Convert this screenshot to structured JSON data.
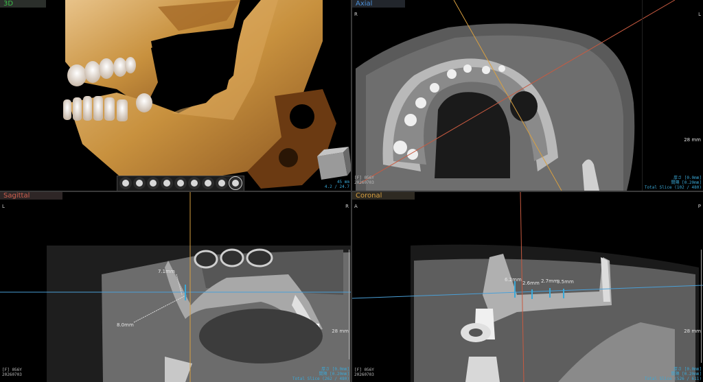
{
  "panels": {
    "threeD": {
      "title": "3D",
      "info_lines": [
        "45 mm",
        "4.2 / 24.7"
      ],
      "toolbar_icons": [
        "view-front-icon",
        "view-left-icon",
        "view-right-icon",
        "view-top-icon",
        "view-back-icon",
        "view-bottom-icon",
        "view-iso-icon",
        "view-mask-icon",
        "reset-view-icon"
      ]
    },
    "axial": {
      "title": "Axial",
      "orient_left": "R",
      "orient_right": "L",
      "scale_label": "28 mm",
      "patient_id": "[F] 056Y",
      "date": "20260703",
      "info_lines": [
        "厚さ [0.0mm]",
        "間隔 [0.20mm]",
        "Total Slice (102 / 480)"
      ]
    },
    "sagittal": {
      "title": "Sagittal",
      "orient_left": "L",
      "orient_right": "R",
      "scale_label": "28 mm",
      "patient_id": "[F] 056Y",
      "date": "20260703",
      "info_lines": [
        "厚さ [0.0mm]",
        "間隔 [0.20mm]",
        "Total Slice (262 / 480)"
      ],
      "measurements": [
        "7.1mm",
        "8.0mm"
      ]
    },
    "coronal": {
      "title": "Coronal",
      "orient_left": "A",
      "orient_right": "P",
      "scale_label": "28 mm",
      "patient_id": "[F] 056Y",
      "date": "20260703",
      "info_lines": [
        "厚さ [0.0mm]",
        "間隔 [0.20mm]",
        "Total Slice (526 / 611)"
      ],
      "measurements": [
        "6.2mm",
        "2.6mm",
        "2.7mm",
        "3.5mm"
      ]
    }
  },
  "colors": {
    "tab_3d": "#3cc04a",
    "tab_axial": "#4b8fd8",
    "tab_sagittal": "#d06050",
    "tab_coronal": "#d9a040",
    "info_text": "#3aa9d8",
    "crosshair_blue": "#4aa0d8",
    "crosshair_orange": "#d9a040",
    "crosshair_red": "#c85a40"
  }
}
